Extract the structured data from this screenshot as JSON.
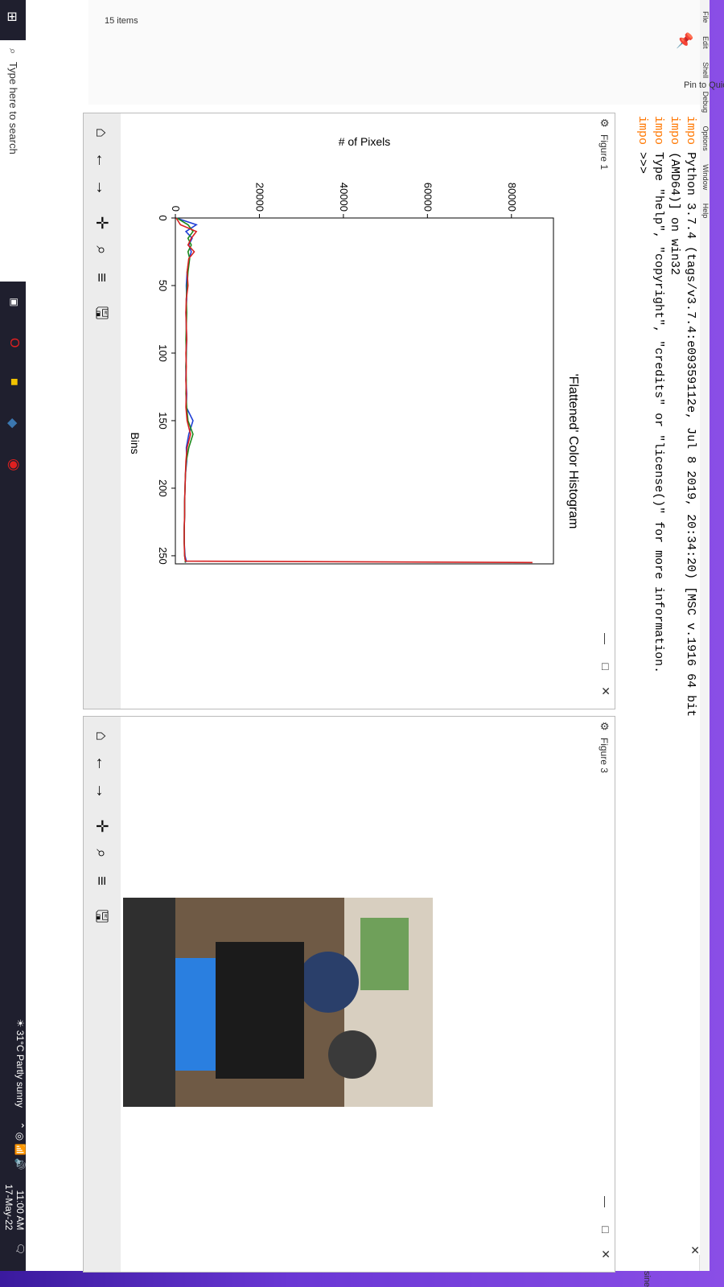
{
  "menubar": {
    "items": [
      "File",
      "Edit",
      "Shell",
      "Debug",
      "Options",
      "Window",
      "Help"
    ]
  },
  "explorer": {
    "pin_label": "Pin to Quick access",
    "items_count": "15 items",
    "right_label": "siness..."
  },
  "shell": {
    "lines": [
      {
        "prefix": "impo",
        "text": "Python 3.7.4 (tags/v3.7.4:e09359112e, Jul  8 2019, 20:34:20) [MSC v.1916 64 bit"
      },
      {
        "prefix": "impo",
        "text": "(AMD64)] on win32"
      },
      {
        "prefix": "impo",
        "text": "Type \"help\", \"copyright\", \"credits\" or \"license()\" for more information."
      },
      {
        "prefix": "impo",
        "text": ">>>"
      }
    ]
  },
  "figure1": {
    "title": "Figure 1",
    "chart_data": {
      "type": "line",
      "title": "'Flattened' Color Histogram",
      "xlabel": "Bins",
      "ylabel": "# of Pixels",
      "xlim": [
        0,
        256
      ],
      "ylim": [
        0,
        90000
      ],
      "xticks": [
        0,
        50,
        100,
        150,
        200,
        250
      ],
      "yticks": [
        0,
        20000,
        40000,
        60000,
        80000
      ],
      "x": [
        0,
        5,
        10,
        15,
        20,
        25,
        30,
        40,
        50,
        60,
        70,
        80,
        90,
        100,
        110,
        120,
        130,
        140,
        150,
        160,
        170,
        180,
        190,
        200,
        210,
        220,
        230,
        240,
        250,
        254,
        255
      ],
      "series": [
        {
          "color": "#1f3fd6",
          "values": [
            200,
            5000,
            2500,
            4000,
            3200,
            3800,
            3300,
            2800,
            2600,
            2700,
            2500,
            2600,
            2700,
            2600,
            2500,
            2500,
            2700,
            2600,
            4200,
            3200,
            2600,
            2700,
            2400,
            2300,
            2200,
            2200,
            2100,
            2100,
            2300,
            2600,
            2300
          ]
        },
        {
          "color": "#1c8a1c",
          "values": [
            300,
            3000,
            4200,
            3000,
            3800,
            3000,
            3400,
            3000,
            2800,
            2600,
            2700,
            2600,
            2500,
            2600,
            2500,
            2600,
            2500,
            2700,
            3000,
            4200,
            3200,
            2600,
            2400,
            2300,
            2200,
            2200,
            2100,
            2100,
            2200,
            2400,
            2300
          ]
        },
        {
          "color": "#d62020",
          "values": [
            200,
            1200,
            5000,
            3800,
            3000,
            4500,
            3200,
            2800,
            3000,
            2600,
            2500,
            2600,
            2700,
            2500,
            2600,
            2500,
            2600,
            2500,
            2800,
            3600,
            2800,
            2500,
            2400,
            2300,
            2200,
            2200,
            2100,
            2100,
            2200,
            2400,
            85000
          ]
        }
      ]
    }
  },
  "figure3": {
    "title": "Figure 3",
    "image_alt": "man in car"
  },
  "taskbar": {
    "search_placeholder": "Type here to search",
    "weather": "31°C  Partly sunny",
    "time": "11:00 AM",
    "date": "17-May-22"
  },
  "colors": {
    "blue": "#1f3fd6",
    "green": "#1c8a1c",
    "red": "#d62020"
  }
}
